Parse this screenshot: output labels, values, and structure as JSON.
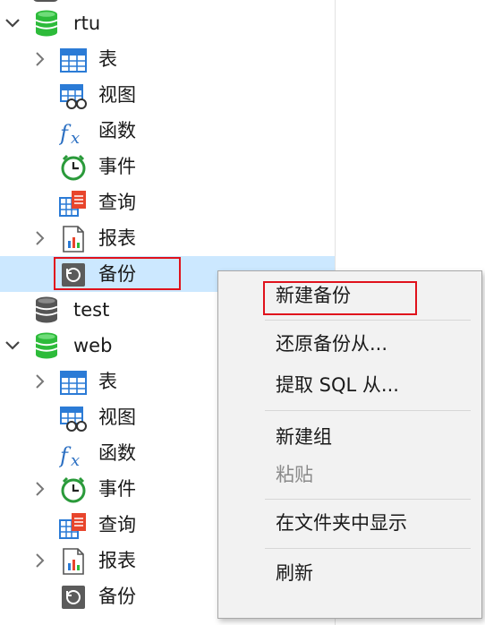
{
  "tree": {
    "databases": [
      {
        "name": "rtu",
        "expanded": true,
        "children": [
          {
            "label": "表",
            "icon": "table-icon",
            "expandable": true
          },
          {
            "label": "视图",
            "icon": "view-icon",
            "expandable": false
          },
          {
            "label": "函数",
            "icon": "function-icon",
            "expandable": false
          },
          {
            "label": "事件",
            "icon": "event-clock-icon",
            "expandable": false
          },
          {
            "label": "查询",
            "icon": "query-icon",
            "expandable": false
          },
          {
            "label": "报表",
            "icon": "report-icon",
            "expandable": true
          },
          {
            "label": "备份",
            "icon": "backup-icon",
            "expandable": false,
            "selected": true
          }
        ]
      },
      {
        "name": "test",
        "expanded": false,
        "children": []
      },
      {
        "name": "web",
        "expanded": true,
        "children": [
          {
            "label": "表",
            "icon": "table-icon",
            "expandable": true
          },
          {
            "label": "视图",
            "icon": "view-icon",
            "expandable": false
          },
          {
            "label": "函数",
            "icon": "function-icon",
            "expandable": false
          },
          {
            "label": "事件",
            "icon": "event-clock-icon",
            "expandable": true
          },
          {
            "label": "查询",
            "icon": "query-icon",
            "expandable": false
          },
          {
            "label": "报表",
            "icon": "report-icon",
            "expandable": true
          },
          {
            "label": "备份",
            "icon": "backup-icon",
            "expandable": false
          }
        ]
      }
    ]
  },
  "context_menu": {
    "items": [
      {
        "label": "新建备份",
        "disabled": false
      },
      {
        "label": "还原备份从...",
        "disabled": false
      },
      {
        "label": "提取 SQL 从...",
        "disabled": false
      },
      {
        "label": "新建组",
        "disabled": false
      },
      {
        "label": "粘贴",
        "disabled": true
      },
      {
        "label": "在文件夹中显示",
        "disabled": false
      },
      {
        "label": "刷新",
        "disabled": false
      }
    ]
  },
  "colors": {
    "selection": "#cce8ff",
    "highlight_box": "#e0121c",
    "db_active": "#2dbb3a",
    "db_inactive": "#555555",
    "table_blue": "#2b7bd6"
  }
}
